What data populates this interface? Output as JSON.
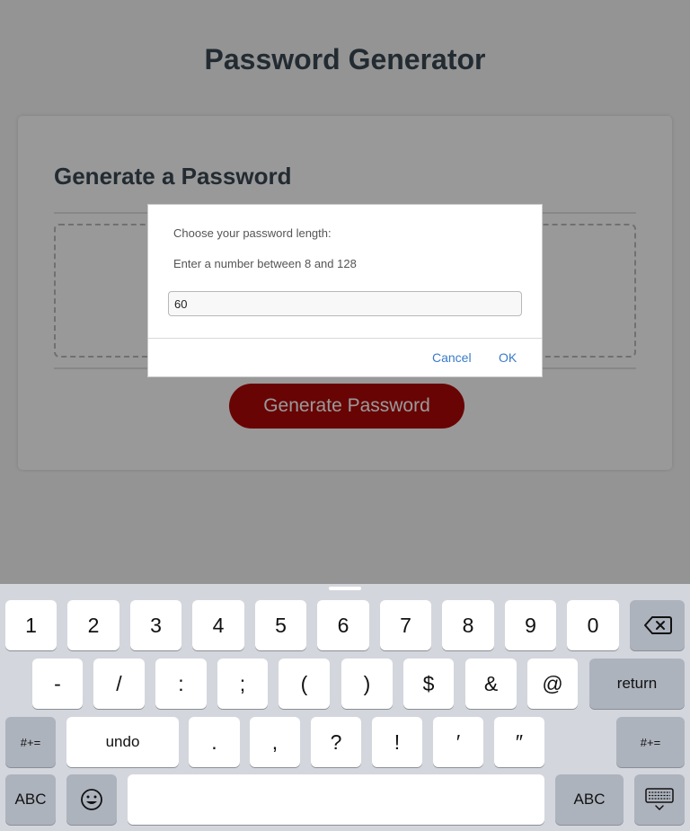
{
  "page": {
    "title": "Password Generator",
    "card_header": "Generate a Password",
    "generate_button": "Generate Password"
  },
  "dialog": {
    "title": "Choose your password length:",
    "message": "Enter a number between 8 and 128",
    "input_value": "60",
    "cancel": "Cancel",
    "ok": "OK"
  },
  "keyboard": {
    "row1": [
      "1",
      "2",
      "3",
      "4",
      "5",
      "6",
      "7",
      "8",
      "9",
      "0"
    ],
    "row2": [
      "-",
      "/",
      ":",
      ";",
      "(",
      ")",
      "$",
      "&",
      "@"
    ],
    "row3": [
      ".",
      ",",
      "?",
      "!",
      "′",
      "″"
    ],
    "return": "return",
    "symbols": "#+=",
    "undo": "undo",
    "abc": "ABC",
    "icons": [
      "backspace-icon",
      "emoji-icon",
      "keyboard-dismiss-icon"
    ]
  },
  "colors": {
    "button": "#b0112c",
    "link": "#3a7bc8",
    "heading": "#3a4a58",
    "keyboard_bg": "#d3d6dc"
  }
}
